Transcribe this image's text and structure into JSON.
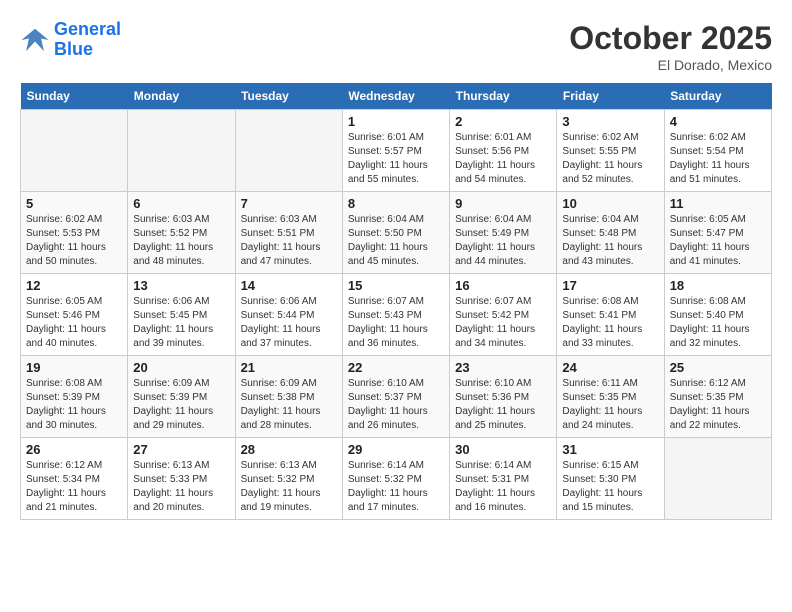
{
  "header": {
    "logo_line1": "General",
    "logo_line2": "Blue",
    "month": "October 2025",
    "location": "El Dorado, Mexico"
  },
  "weekdays": [
    "Sunday",
    "Monday",
    "Tuesday",
    "Wednesday",
    "Thursday",
    "Friday",
    "Saturday"
  ],
  "weeks": [
    [
      {
        "day": "",
        "info": ""
      },
      {
        "day": "",
        "info": ""
      },
      {
        "day": "",
        "info": ""
      },
      {
        "day": "1",
        "info": "Sunrise: 6:01 AM\nSunset: 5:57 PM\nDaylight: 11 hours\nand 55 minutes."
      },
      {
        "day": "2",
        "info": "Sunrise: 6:01 AM\nSunset: 5:56 PM\nDaylight: 11 hours\nand 54 minutes."
      },
      {
        "day": "3",
        "info": "Sunrise: 6:02 AM\nSunset: 5:55 PM\nDaylight: 11 hours\nand 52 minutes."
      },
      {
        "day": "4",
        "info": "Sunrise: 6:02 AM\nSunset: 5:54 PM\nDaylight: 11 hours\nand 51 minutes."
      }
    ],
    [
      {
        "day": "5",
        "info": "Sunrise: 6:02 AM\nSunset: 5:53 PM\nDaylight: 11 hours\nand 50 minutes."
      },
      {
        "day": "6",
        "info": "Sunrise: 6:03 AM\nSunset: 5:52 PM\nDaylight: 11 hours\nand 48 minutes."
      },
      {
        "day": "7",
        "info": "Sunrise: 6:03 AM\nSunset: 5:51 PM\nDaylight: 11 hours\nand 47 minutes."
      },
      {
        "day": "8",
        "info": "Sunrise: 6:04 AM\nSunset: 5:50 PM\nDaylight: 11 hours\nand 45 minutes."
      },
      {
        "day": "9",
        "info": "Sunrise: 6:04 AM\nSunset: 5:49 PM\nDaylight: 11 hours\nand 44 minutes."
      },
      {
        "day": "10",
        "info": "Sunrise: 6:04 AM\nSunset: 5:48 PM\nDaylight: 11 hours\nand 43 minutes."
      },
      {
        "day": "11",
        "info": "Sunrise: 6:05 AM\nSunset: 5:47 PM\nDaylight: 11 hours\nand 41 minutes."
      }
    ],
    [
      {
        "day": "12",
        "info": "Sunrise: 6:05 AM\nSunset: 5:46 PM\nDaylight: 11 hours\nand 40 minutes."
      },
      {
        "day": "13",
        "info": "Sunrise: 6:06 AM\nSunset: 5:45 PM\nDaylight: 11 hours\nand 39 minutes."
      },
      {
        "day": "14",
        "info": "Sunrise: 6:06 AM\nSunset: 5:44 PM\nDaylight: 11 hours\nand 37 minutes."
      },
      {
        "day": "15",
        "info": "Sunrise: 6:07 AM\nSunset: 5:43 PM\nDaylight: 11 hours\nand 36 minutes."
      },
      {
        "day": "16",
        "info": "Sunrise: 6:07 AM\nSunset: 5:42 PM\nDaylight: 11 hours\nand 34 minutes."
      },
      {
        "day": "17",
        "info": "Sunrise: 6:08 AM\nSunset: 5:41 PM\nDaylight: 11 hours\nand 33 minutes."
      },
      {
        "day": "18",
        "info": "Sunrise: 6:08 AM\nSunset: 5:40 PM\nDaylight: 11 hours\nand 32 minutes."
      }
    ],
    [
      {
        "day": "19",
        "info": "Sunrise: 6:08 AM\nSunset: 5:39 PM\nDaylight: 11 hours\nand 30 minutes."
      },
      {
        "day": "20",
        "info": "Sunrise: 6:09 AM\nSunset: 5:39 PM\nDaylight: 11 hours\nand 29 minutes."
      },
      {
        "day": "21",
        "info": "Sunrise: 6:09 AM\nSunset: 5:38 PM\nDaylight: 11 hours\nand 28 minutes."
      },
      {
        "day": "22",
        "info": "Sunrise: 6:10 AM\nSunset: 5:37 PM\nDaylight: 11 hours\nand 26 minutes."
      },
      {
        "day": "23",
        "info": "Sunrise: 6:10 AM\nSunset: 5:36 PM\nDaylight: 11 hours\nand 25 minutes."
      },
      {
        "day": "24",
        "info": "Sunrise: 6:11 AM\nSunset: 5:35 PM\nDaylight: 11 hours\nand 24 minutes."
      },
      {
        "day": "25",
        "info": "Sunrise: 6:12 AM\nSunset: 5:35 PM\nDaylight: 11 hours\nand 22 minutes."
      }
    ],
    [
      {
        "day": "26",
        "info": "Sunrise: 6:12 AM\nSunset: 5:34 PM\nDaylight: 11 hours\nand 21 minutes."
      },
      {
        "day": "27",
        "info": "Sunrise: 6:13 AM\nSunset: 5:33 PM\nDaylight: 11 hours\nand 20 minutes."
      },
      {
        "day": "28",
        "info": "Sunrise: 6:13 AM\nSunset: 5:32 PM\nDaylight: 11 hours\nand 19 minutes."
      },
      {
        "day": "29",
        "info": "Sunrise: 6:14 AM\nSunset: 5:32 PM\nDaylight: 11 hours\nand 17 minutes."
      },
      {
        "day": "30",
        "info": "Sunrise: 6:14 AM\nSunset: 5:31 PM\nDaylight: 11 hours\nand 16 minutes."
      },
      {
        "day": "31",
        "info": "Sunrise: 6:15 AM\nSunset: 5:30 PM\nDaylight: 11 hours\nand 15 minutes."
      },
      {
        "day": "",
        "info": ""
      }
    ]
  ]
}
